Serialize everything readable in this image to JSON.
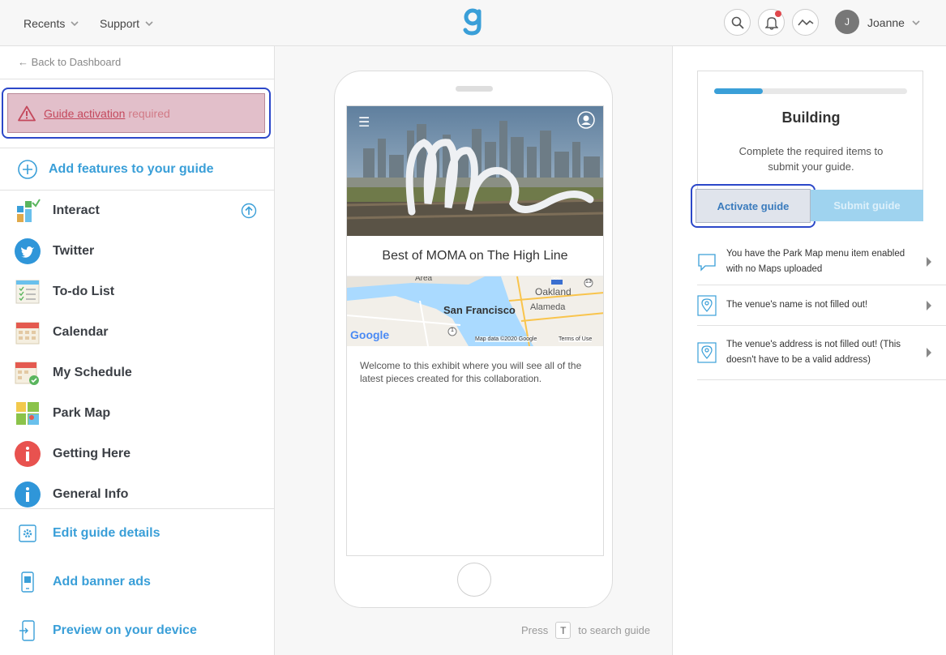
{
  "topbar": {
    "recents": "Recents",
    "support": "Support",
    "avatar_initial": "J",
    "username": "Joanne"
  },
  "sidebar": {
    "back": "← Back to Dashboard",
    "alert_link": "Guide activation",
    "alert_rest": "required",
    "add_features": "Add features to your guide",
    "features": [
      {
        "label": "Interact",
        "icon": "interact-icon"
      },
      {
        "label": "Twitter",
        "icon": "twitter-icon"
      },
      {
        "label": "To-do List",
        "icon": "todo-list-icon"
      },
      {
        "label": "Calendar",
        "icon": "calendar-icon"
      },
      {
        "label": "My Schedule",
        "icon": "schedule-icon"
      },
      {
        "label": "Park Map",
        "icon": "map-icon"
      },
      {
        "label": "Getting Here",
        "icon": "info-red-icon"
      },
      {
        "label": "General Info",
        "icon": "info-blue-icon"
      }
    ],
    "bottom": [
      {
        "label": "Edit guide details",
        "icon": "gear-icon"
      },
      {
        "label": "Add banner ads",
        "icon": "phone-icon"
      },
      {
        "label": "Preview on your device",
        "icon": "preview-icon"
      }
    ]
  },
  "preview": {
    "guide_title": "Best of MOMA on The High Line",
    "description": "Welcome to this exhibit where you will see all of the latest pieces created for this collaboration.",
    "map_labels": {
      "city": "San Francisco",
      "oakland": "Oakland",
      "alameda": "Alameda",
      "area": "Area",
      "google": "Google",
      "attribution": "Map data ©2020 Google",
      "terms": "Terms of Use",
      "hw580": "580",
      "hw13": "13",
      "hw1": "1"
    },
    "hint_press": "Press",
    "hint_key": "T",
    "hint_rest": "to search guide"
  },
  "status": {
    "progress": 0.25,
    "title": "Building",
    "subtitle": "Complete the required items to submit your guide.",
    "activate_label": "Activate guide",
    "submit_label": "Submit guide",
    "issues": [
      {
        "text": "You have the Park Map menu item enabled with no Maps uploaded",
        "icon": "chat-bubble-icon"
      },
      {
        "text": "The venue's name is not filled out!",
        "icon": "map-pin-icon"
      },
      {
        "text": "The venue's address is not filled out! (This doesn't have to be a valid address)",
        "icon": "map-pin-icon"
      }
    ]
  },
  "colors": {
    "accent": "#3a9fd8",
    "alert_bg": "#e2bfca",
    "alert_text": "#c4485c",
    "focus_ring": "#2c48c9"
  }
}
